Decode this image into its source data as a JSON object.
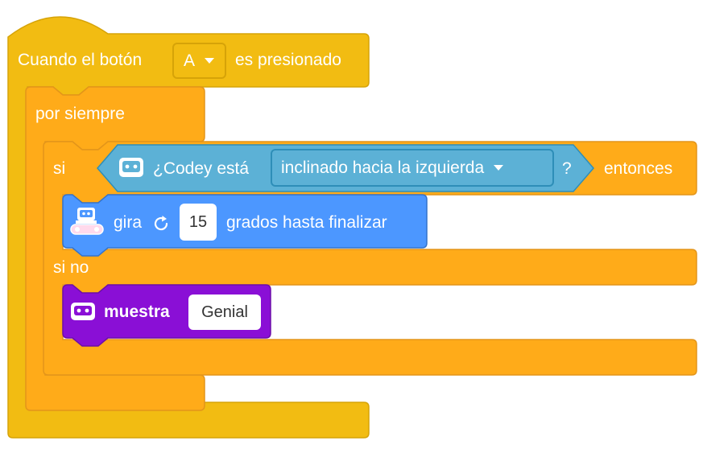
{
  "colors": {
    "events": "#f2bc12",
    "events_edge": "#d6a308",
    "control": "#ffab19",
    "control_edge": "#e3951a",
    "sensing": "#5cb1d6",
    "sensing_edge": "#2e8eb8",
    "motion": "#4c97ff",
    "motion_edge": "#3373cc",
    "looks": "#8a0fd6",
    "looks_edge": "#6c0fa8"
  },
  "hat_block": {
    "prefix": "Cuando el botón",
    "button_value": "A",
    "suffix": "es presionado"
  },
  "forever_block": {
    "label": "por siempre"
  },
  "if_else_block": {
    "if_label": "si",
    "then_label": "entonces",
    "else_label": "si no"
  },
  "sensing_block": {
    "icon": "codey-icon",
    "label": "¿Codey está",
    "option": "inclinado hacia la izquierda",
    "question": "?"
  },
  "turn_block": {
    "icon": "rover-icon",
    "label": "gira",
    "rotate_icon": "rotate-clockwise-icon",
    "degrees": "15",
    "suffix": "grados hasta finalizar"
  },
  "show_block": {
    "icon": "codey-icon",
    "label": "muestra",
    "text": "Genial"
  }
}
